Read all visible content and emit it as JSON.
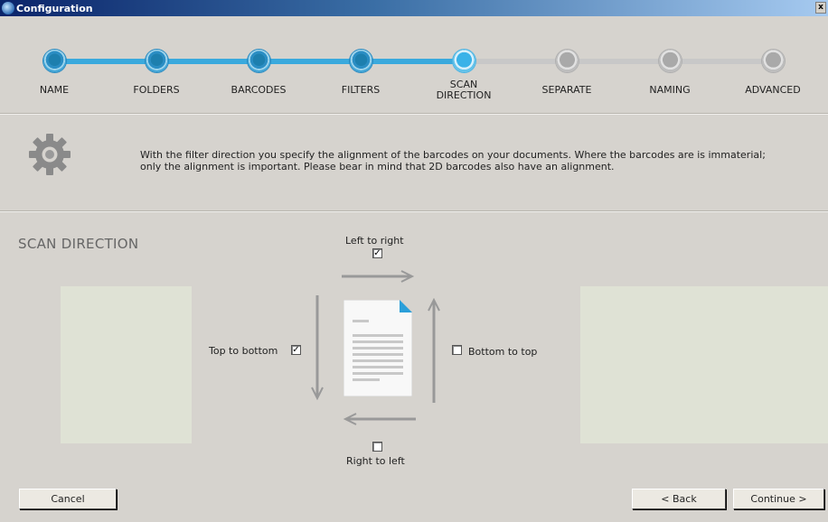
{
  "window": {
    "title": "Configuration",
    "close_label": "x"
  },
  "steps": [
    {
      "label": "NAME",
      "state": "done"
    },
    {
      "label": "FOLDERS",
      "state": "done"
    },
    {
      "label": "BARCODES",
      "state": "done"
    },
    {
      "label": "FILTERS",
      "state": "done"
    },
    {
      "label": "SCAN\nDIRECTION",
      "state": "active"
    },
    {
      "label": "SEPARATE",
      "state": "todo"
    },
    {
      "label": "NAMING",
      "state": "todo"
    },
    {
      "label": "ADVANCED",
      "state": "todo"
    }
  ],
  "info": {
    "text": "With the filter direction you specify the alignment of the barcodes on your documents. Where the barcodes are is immaterial;\nonly the alignment is important. Please bear in mind that 2D barcodes also have an alignment."
  },
  "scan": {
    "title": "SCAN DIRECTION",
    "left_to_right": {
      "label": "Left to right",
      "checked": true
    },
    "top_to_bottom": {
      "label": "Top to bottom",
      "checked": true
    },
    "bottom_to_top": {
      "label": "Bottom to top",
      "checked": false
    },
    "right_to_left": {
      "label": "Right to left",
      "checked": false
    }
  },
  "buttons": {
    "cancel": "Cancel",
    "back": "< Back",
    "continue": "Continue >"
  },
  "colors": {
    "accent": "#3aa9dd",
    "track_done": "#3aa9dd",
    "track_todo": "#c8c8c8",
    "panel": "#dfe2d5"
  }
}
